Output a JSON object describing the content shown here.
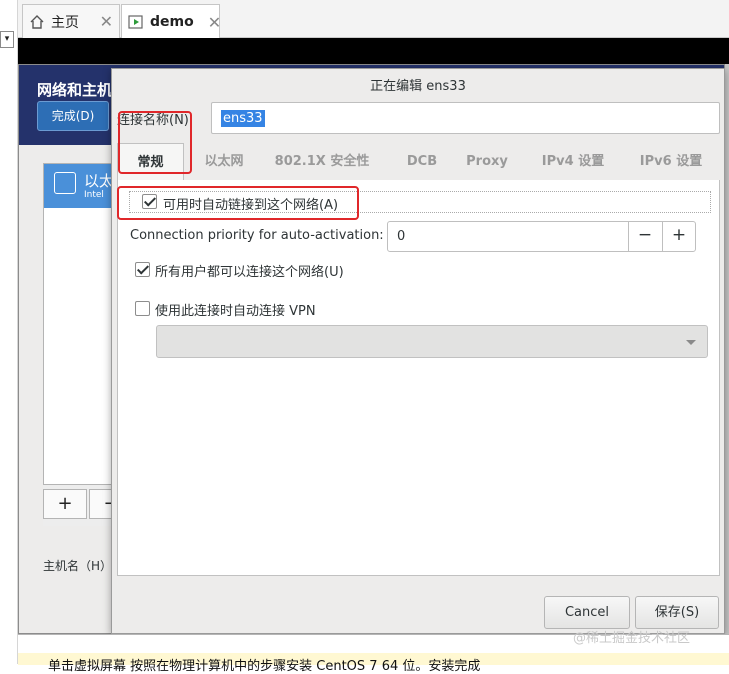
{
  "host": {
    "tabs": [
      {
        "label": "主页",
        "icon": "home-icon",
        "closable": true,
        "active": false
      },
      {
        "label": "demo",
        "icon": "vm-icon",
        "closable": true,
        "active": true
      }
    ],
    "close_glyph": "✕",
    "dropdown_glyph": "▾",
    "status_hint": "单击虚拟屏幕  按照在物理计算机中的步骤安装 CentOS 7 64 位。安装完成"
  },
  "background": {
    "title": "网络和主机名",
    "done_label": "完成(D)",
    "device": {
      "name": "以太网",
      "sub": "Intel"
    },
    "add_label": "+",
    "remove_label": "−",
    "hostname_label": "主机名（H）"
  },
  "dialog": {
    "title": "正在编辑 ens33",
    "connection_name_label": "连接名称(N)",
    "connection_name_value": "ens33",
    "tabs": [
      "常规",
      "以太网",
      "802.1X 安全性",
      "DCB",
      "Proxy",
      "IPv4 设置",
      "IPv6 设置"
    ],
    "active_tab": "常规",
    "general": {
      "auto_connect_label": "可用时自动链接到这个网络(A)",
      "auto_connect_checked": true,
      "priority_label": "Connection priority for auto-activation:",
      "priority_value": "0",
      "minus": "−",
      "plus": "+",
      "all_users_label": "所有用户都可以连接这个网络(U)",
      "all_users_checked": true,
      "vpn_label": "使用此连接时自动连接 VPN",
      "vpn_checked": false,
      "vpn_selected": ""
    },
    "cancel_label": "Cancel",
    "save_label": "保存(S)"
  },
  "annotations": {
    "highlight_color": "#e0272a"
  },
  "watermark": "@稀土掘金技术社区"
}
